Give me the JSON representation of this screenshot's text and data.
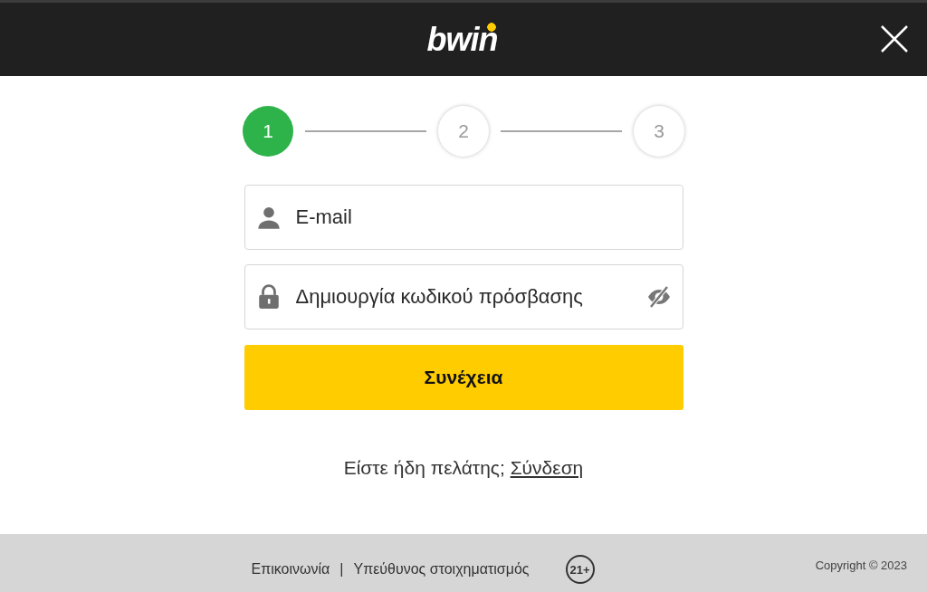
{
  "header": {
    "logo": "bwin"
  },
  "steps": [
    {
      "label": "1",
      "selected": true
    },
    {
      "label": "2",
      "selected": false
    },
    {
      "label": "3",
      "selected": false
    }
  ],
  "fields": [
    {
      "kind": "email",
      "placeholder": "E-mail"
    },
    {
      "kind": "password",
      "placeholder": "Δημιουργία κωδικού πρόσβασης"
    }
  ],
  "continue_button": "Συνέχεια",
  "login_prompt": {
    "text": "Είστε ήδη πελάτης;",
    "link": "Σύνδεση"
  },
  "footer": {
    "links": [
      "Επικοινωνία",
      "Υπεύθυνος στοιχηματισμός"
    ],
    "separator": "|",
    "age_badge": "21+",
    "copyright": "Copyright © 2023"
  }
}
